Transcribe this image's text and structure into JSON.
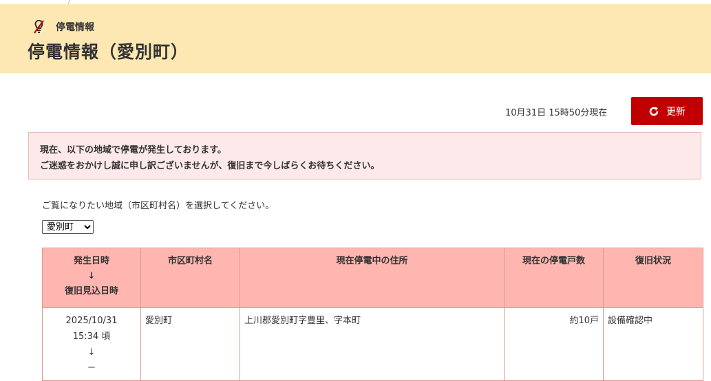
{
  "header": {
    "breadcrumb": "停電情報",
    "title": "停電情報（愛別町）"
  },
  "status": {
    "timestamp": "10月31日 15時50分現在",
    "refresh_label": "更新"
  },
  "alert": {
    "line1": "現在、以下の地域で停電が発生しております。",
    "line2": "ご迷惑をおかけし誠に申し訳ございませんが、復旧まで今しばらくお待ちください。"
  },
  "selector": {
    "instruction": "ご覧になりたい地域（市区町村名）を選択してください。",
    "selected": "愛別町"
  },
  "table": {
    "headers": {
      "date_line1": "発生日時",
      "date_arrow": "↓",
      "date_line2": "復旧見込日時",
      "city": "市区町村名",
      "address": "現在停電中の住所",
      "count": "現在の停電戸数",
      "status": "復旧状況"
    },
    "rows": [
      {
        "date": "2025/10/31",
        "time": "15:34 頃",
        "arrow": "↓",
        "restore": "－",
        "city": "愛別町",
        "address": "上川郡愛別町字豊里、字本町",
        "count": "約10戸",
        "status": "設備確認中"
      }
    ]
  },
  "colors": {
    "header_bg": "#fde8b4",
    "refresh_button": "#c00000",
    "alert_bg": "#fde9e9",
    "table_header_bg": "#ffb6b0"
  }
}
